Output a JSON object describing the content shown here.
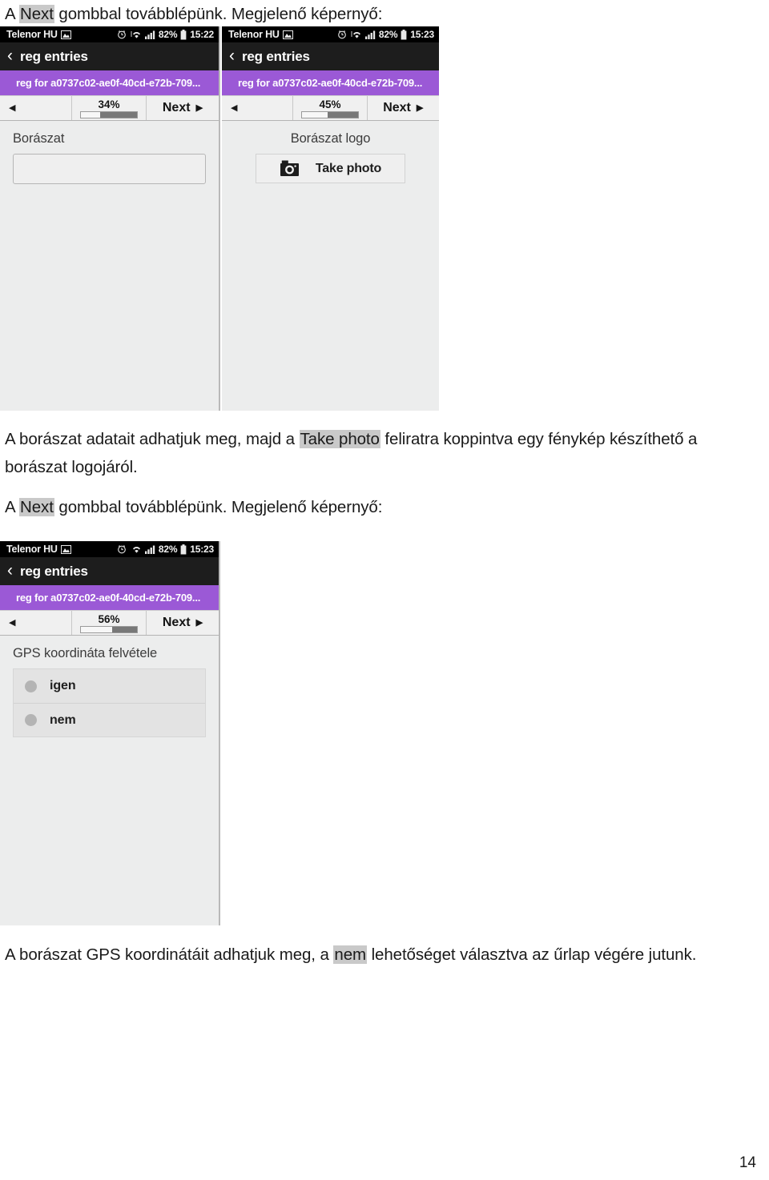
{
  "document": {
    "page_number": "14",
    "paragraphs": [
      {
        "id": "p-top",
        "segments": [
          {
            "text": "A ",
            "highlight": false
          },
          {
            "text": "Next",
            "highlight": true
          },
          {
            "text": " gombbal továbblépünk. Megjelenő képernyő:",
            "highlight": false
          }
        ]
      },
      {
        "id": "p-mid-1",
        "segments": [
          {
            "text": "A borászat adatait adhatjuk meg, majd a ",
            "highlight": false
          },
          {
            "text": "Take photo",
            "highlight": true
          },
          {
            "text": " feliratra koppintva egy fénykép készíthető a",
            "highlight": false
          }
        ]
      },
      {
        "id": "p-mid-2",
        "segments": [
          {
            "text": "borászat logojáról.",
            "highlight": false
          }
        ]
      },
      {
        "id": "p-mid-3",
        "segments": [
          {
            "text": "A ",
            "highlight": false
          },
          {
            "text": "Next",
            "highlight": true
          },
          {
            "text": " gombbal továbblépünk. Megjelenő képernyő:",
            "highlight": false
          }
        ]
      },
      {
        "id": "p-bottom",
        "segments": [
          {
            "text": "A borászat GPS koordinátáit adhatjuk meg, a ",
            "highlight": false
          },
          {
            "text": "nem",
            "highlight": true
          },
          {
            "text": " lehetőséget választva az űrlap végére jutunk.",
            "highlight": false
          }
        ]
      }
    ]
  },
  "colors": {
    "entry_bar_purple": "#9b59d6",
    "status_bar_black": "#000000",
    "title_bar_black": "#1d1d1d",
    "form_background": "#eceded",
    "highlight_gray": "#c9c9c9"
  },
  "screenshots": [
    {
      "id": "shot-1",
      "status_bar": {
        "carrier": "Telenor HU",
        "picture_icon": "image-icon",
        "alarm_icon": "alarm-clock-icon",
        "wifi_icon": "wifi-icon",
        "signal_icon": "signal-bars-icon",
        "battery_text": "82%",
        "battery_icon": "battery-icon",
        "time": "15:22"
      },
      "title_bar": {
        "back_icon": "chevron-left-icon",
        "title": "reg entries"
      },
      "entry_bar": {
        "text": "reg for a0737c02-ae0f-40cd-e72b-709..."
      },
      "nav_bar": {
        "prev_icon": "triangle-left-icon",
        "progress_label": "34%",
        "progress_value": 34,
        "next_label": "Next",
        "next_icon": "triangle-right-icon"
      },
      "form": {
        "type": "text-field",
        "label": "Borászat",
        "input_value": "",
        "input_placeholder": ""
      }
    },
    {
      "id": "shot-2",
      "status_bar": {
        "carrier": "Telenor HU",
        "picture_icon": "image-icon",
        "alarm_icon": "alarm-clock-icon",
        "wifi_icon": "wifi-icon",
        "signal_icon": "signal-bars-icon",
        "battery_text": "82%",
        "battery_icon": "battery-icon",
        "time": "15:23"
      },
      "title_bar": {
        "back_icon": "chevron-left-icon",
        "title": "reg entries"
      },
      "entry_bar": {
        "text": "reg for a0737c02-ae0f-40cd-e72b-709..."
      },
      "nav_bar": {
        "prev_icon": "triangle-left-icon",
        "progress_label": "45%",
        "progress_value": 45,
        "next_label": "Next",
        "next_icon": "triangle-right-icon"
      },
      "form": {
        "type": "photo-button",
        "label": "Borászat logo",
        "button_label": "Take photo",
        "button_icon": "camera-icon"
      }
    },
    {
      "id": "shot-3",
      "status_bar": {
        "carrier": "Telenor HU",
        "picture_icon": "image-icon",
        "alarm_icon": "alarm-clock-icon",
        "wifi_icon": "wifi-icon",
        "signal_icon": "signal-bars-icon",
        "battery_text": "82%",
        "battery_icon": "battery-icon",
        "time": "15:23"
      },
      "title_bar": {
        "back_icon": "chevron-left-icon",
        "title": "reg entries"
      },
      "entry_bar": {
        "text": "reg for a0737c02-ae0f-40cd-e72b-709..."
      },
      "nav_bar": {
        "prev_icon": "triangle-left-icon",
        "progress_label": "56%",
        "progress_value": 56,
        "next_label": "Next",
        "next_icon": "triangle-right-icon"
      },
      "form": {
        "type": "radio-group",
        "label": "GPS koordináta felvétele",
        "options": [
          {
            "label": "igen",
            "selected": false
          },
          {
            "label": "nem",
            "selected": false
          }
        ]
      }
    }
  ]
}
